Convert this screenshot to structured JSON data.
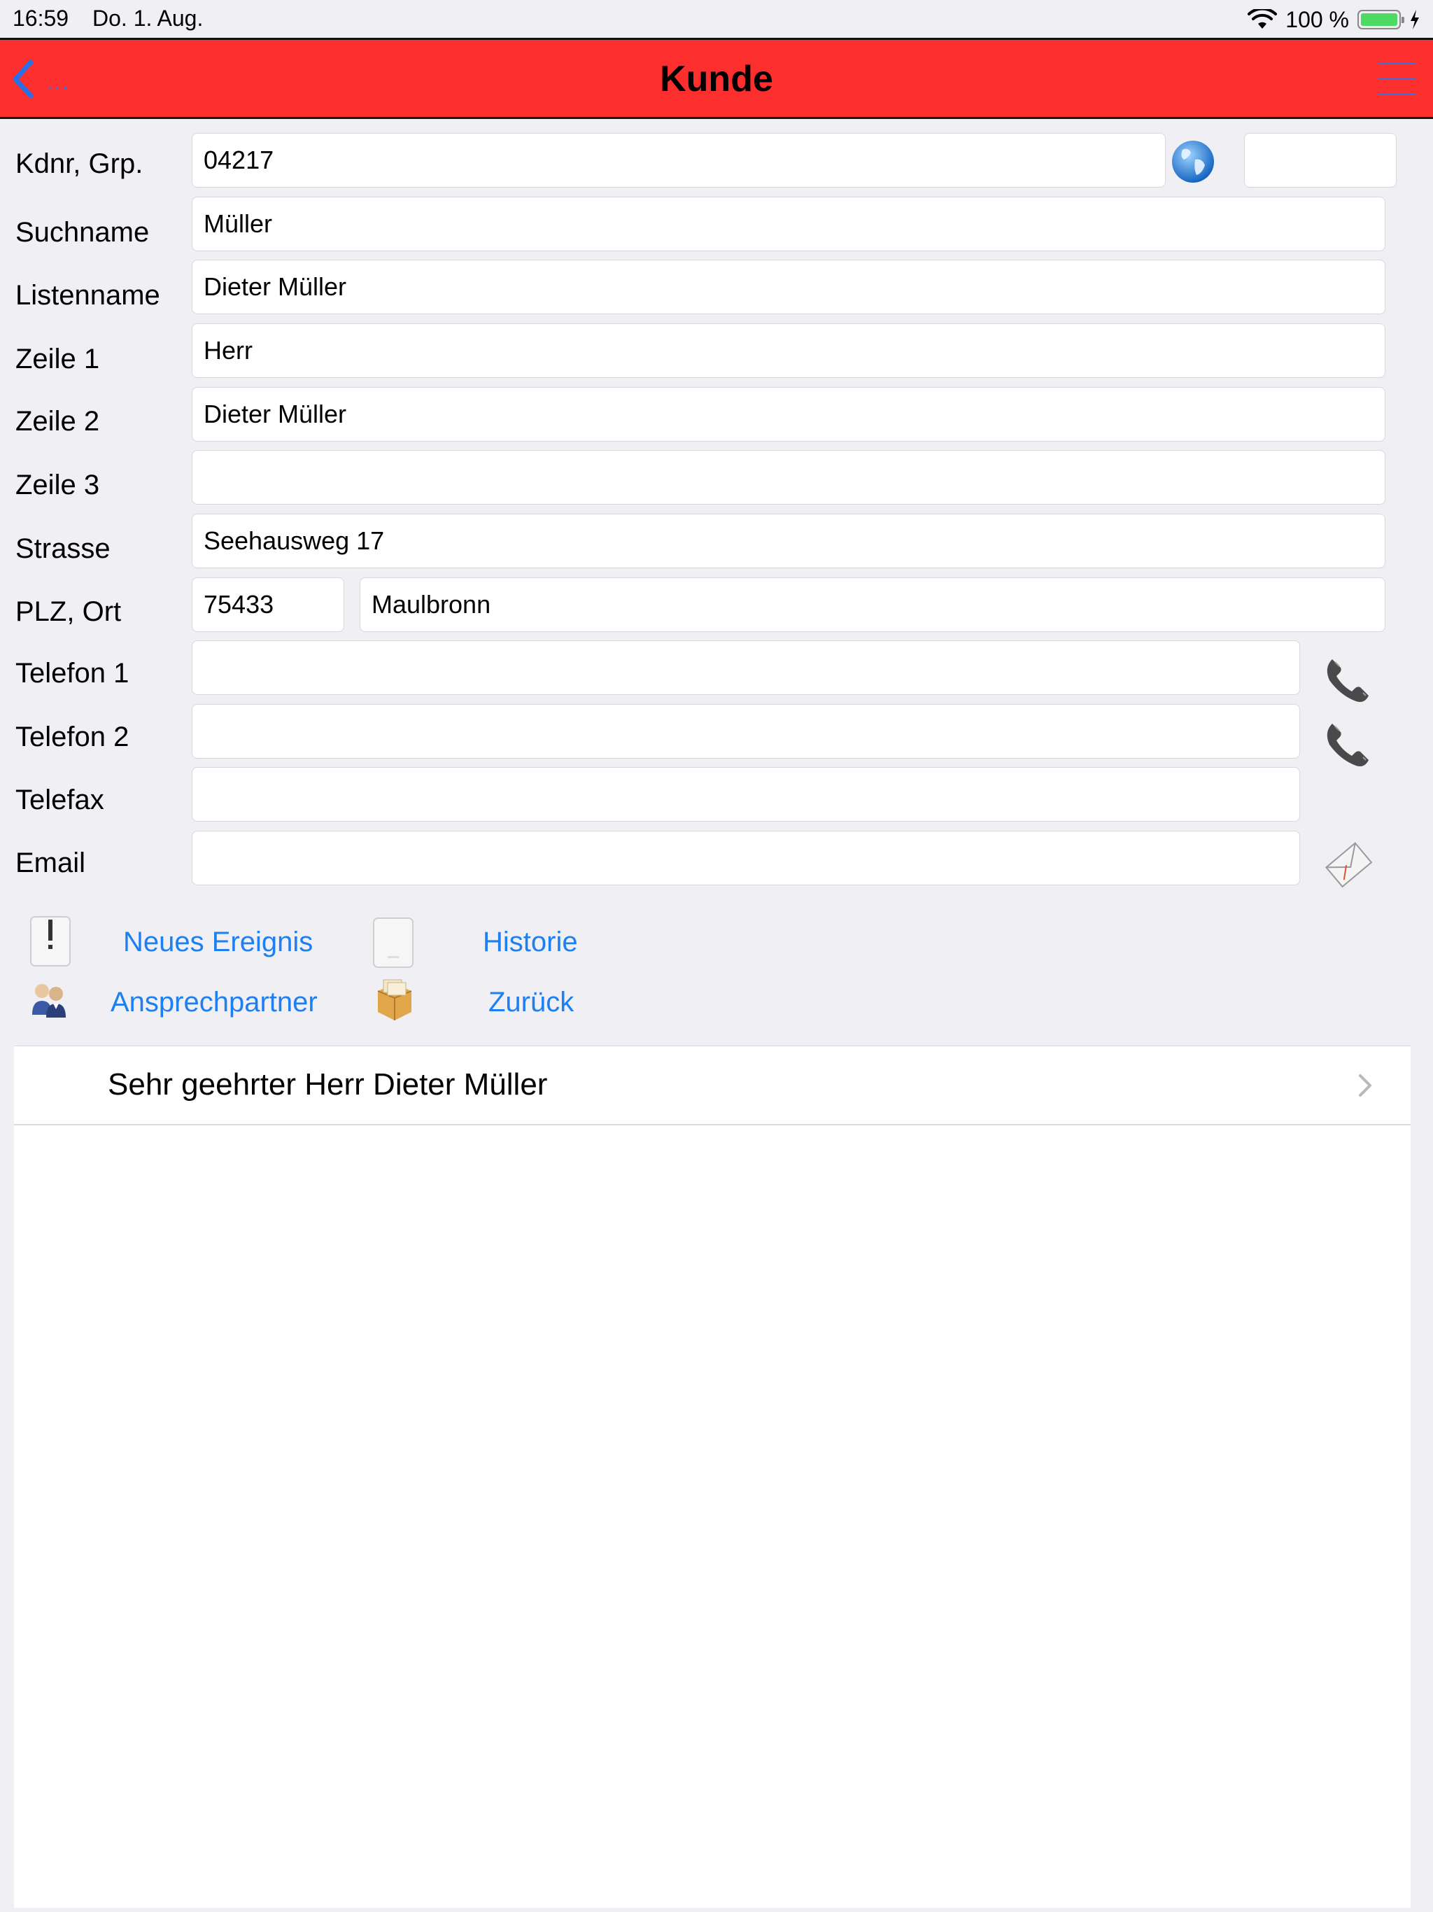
{
  "status_bar": {
    "time": "16:59",
    "date": "Do. 1. Aug.",
    "battery_percent": "100 %",
    "battery_level": 1.0
  },
  "nav": {
    "title": "Kunde",
    "back_label": "...",
    "accent_color": "#fd2e2e",
    "link_color": "#3f6fd8"
  },
  "form": {
    "kdnr_label": "Kdnr, Grp.",
    "kdnr_value": "04217",
    "grp_value": "",
    "suchname_label": "Suchname",
    "suchname_value": "Müller",
    "listenname_label": "Listenname",
    "listenname_value": "Dieter Müller",
    "zeile1_label": "Zeile 1",
    "zeile1_value": "Herr",
    "zeile2_label": "Zeile 2",
    "zeile2_value": "Dieter Müller",
    "zeile3_label": "Zeile 3",
    "zeile3_value": "",
    "strasse_label": "Strasse",
    "strasse_value": "Seehausweg 17",
    "plz_ort_label": "PLZ, Ort",
    "plz_value": "75433",
    "ort_value": "Maulbronn",
    "telefon1_label": "Telefon 1",
    "telefon1_value": "",
    "telefon2_label": "Telefon 2",
    "telefon2_value": "",
    "telefax_label": "Telefax",
    "telefax_value": "",
    "email_label": "Email",
    "email_value": ""
  },
  "actions": {
    "neues_ereignis": "Neues Ereignis",
    "historie": "Historie",
    "ansprechpartner": "Ansprechpartner",
    "zurueck": "Zurück",
    "link_color": "#1e7ff0"
  },
  "list": {
    "items": [
      {
        "label": "Sehr geehrter Herr Dieter Müller"
      }
    ]
  }
}
